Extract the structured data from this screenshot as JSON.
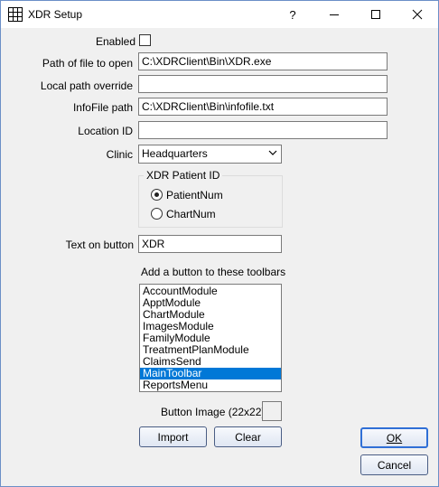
{
  "window": {
    "title": "XDR Setup",
    "help_glyph": "?"
  },
  "fields": {
    "enabled_label": "Enabled",
    "path_label": "Path of file to open",
    "path_value": "C:\\XDRClient\\Bin\\XDR.exe",
    "local_override_label": "Local path override",
    "local_override_value": "",
    "infofile_label": "InfoFile path",
    "infofile_value": "C:\\XDRClient\\Bin\\infofile.txt",
    "location_label": "Location ID",
    "location_value": "",
    "clinic_label": "Clinic",
    "clinic_value": "Headquarters",
    "text_on_button_label": "Text on button",
    "text_on_button_value": "XDR"
  },
  "patient_id": {
    "group_title": "XDR Patient ID",
    "options": [
      "PatientNum",
      "ChartNum"
    ],
    "selected": "PatientNum"
  },
  "toolbars": {
    "label": "Add a button to these toolbars",
    "items": [
      "AccountModule",
      "ApptModule",
      "ChartModule",
      "ImagesModule",
      "FamilyModule",
      "TreatmentPlanModule",
      "ClaimsSend",
      "MainToolbar",
      "ReportsMenu"
    ],
    "selected": "MainToolbar"
  },
  "button_image": {
    "label": "Button Image (22x22)"
  },
  "buttons": {
    "import": "Import",
    "clear": "Clear",
    "ok": "OK",
    "cancel": "Cancel"
  },
  "icons": [
    "app-grid-icon",
    "help-icon",
    "minimize-icon",
    "maximize-icon",
    "close-icon",
    "chevron-down-icon"
  ]
}
